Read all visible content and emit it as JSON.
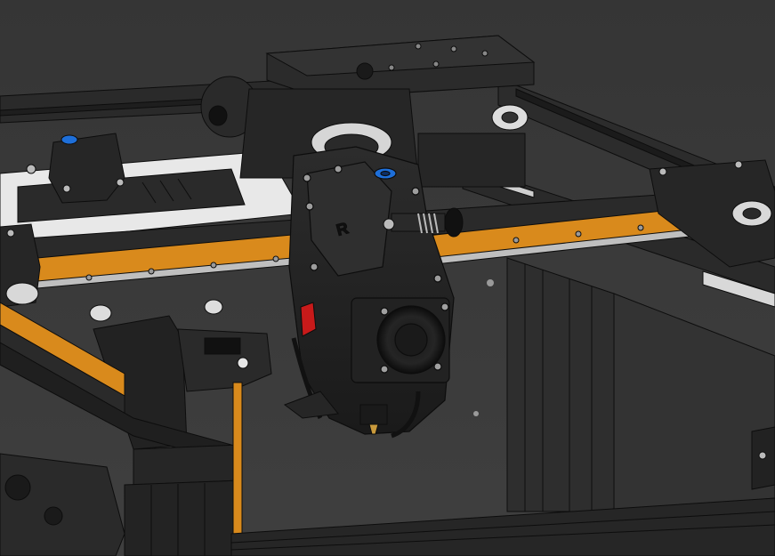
{
  "scene": {
    "kind": "3d-cad-render",
    "subject": "3d-printer-gantry",
    "colors": {
      "background": "#3a3a3a",
      "frame_dark": "#1f1f1f",
      "part_black": "#262626",
      "part_edge": "#0d0d0d",
      "rail_orange": "#d98a1c",
      "rail_steel": "#bfbfbf",
      "white_part": "#e6e6e6",
      "accent_blue": "#1e6fd9",
      "accent_red": "#c81a1a"
    }
  }
}
